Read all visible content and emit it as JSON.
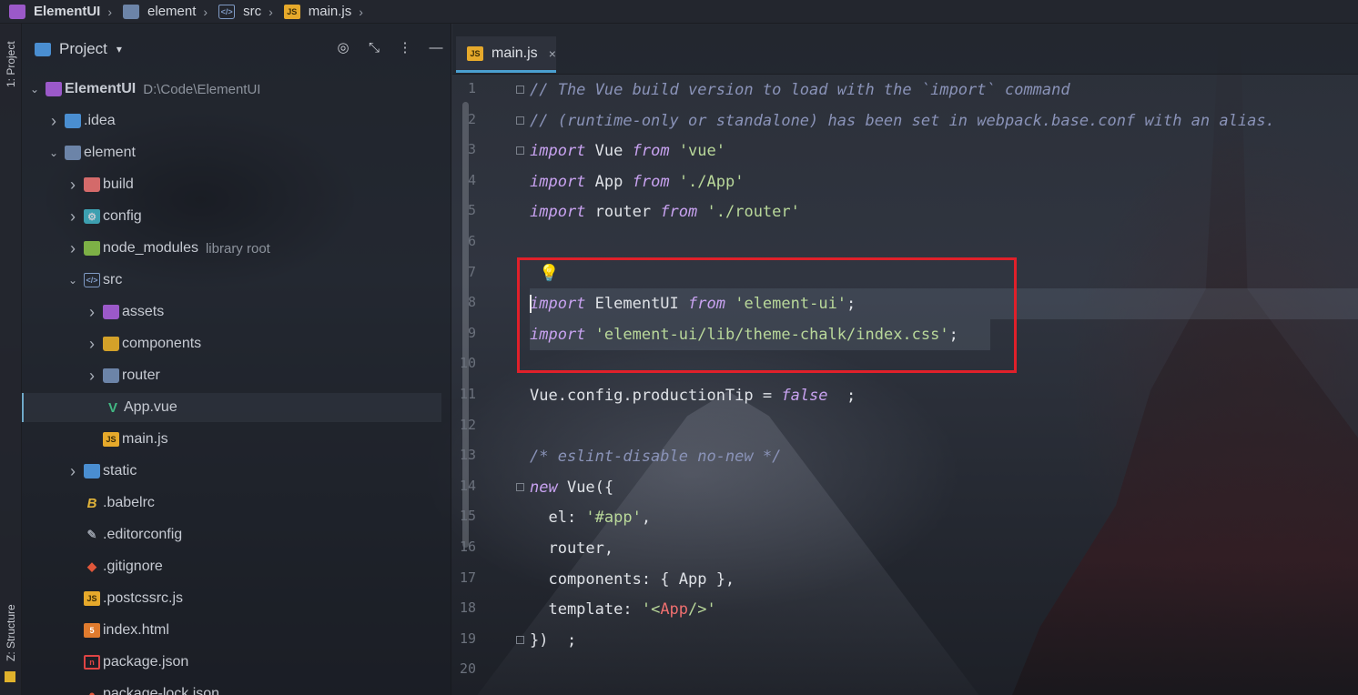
{
  "breadcrumb": [
    {
      "label": "ElementUI",
      "icon": "project-icon"
    },
    {
      "label": "element",
      "icon": "folder-icon"
    },
    {
      "label": "src",
      "icon": "src-folder-icon"
    },
    {
      "label": "main.js",
      "icon": "js-file-icon"
    }
  ],
  "toolstrip": {
    "project_tab": "1: Project",
    "structure_tab": "Z: Structure"
  },
  "project_panel": {
    "title": "Project",
    "dropdown_icon": "chevron-down-icon",
    "tools": [
      "locate-icon",
      "collapse-icon",
      "more-vertical-icon",
      "minimize-icon"
    ]
  },
  "tree": [
    {
      "name": "ElementUI",
      "suffix": "D:\\Code\\ElementUI",
      "depth": 0,
      "arrow": "down",
      "icon": "project"
    },
    {
      "name": ".idea",
      "suffix": "",
      "depth": 1,
      "arrow": "right",
      "icon": "folder-blue"
    },
    {
      "name": "element",
      "suffix": "",
      "depth": 1,
      "arrow": "down",
      "icon": "folder"
    },
    {
      "name": "build",
      "suffix": "",
      "depth": 2,
      "arrow": "right",
      "icon": "folder-red"
    },
    {
      "name": "config",
      "suffix": "",
      "depth": 2,
      "arrow": "right",
      "icon": "folder-teal"
    },
    {
      "name": "node_modules",
      "suffix": "library root",
      "depth": 2,
      "arrow": "right",
      "icon": "folder-green"
    },
    {
      "name": "src",
      "suffix": "",
      "depth": 2,
      "arrow": "down",
      "icon": "folder-src"
    },
    {
      "name": "assets",
      "suffix": "",
      "depth": 3,
      "arrow": "right",
      "icon": "folder-purple"
    },
    {
      "name": "components",
      "suffix": "",
      "depth": 3,
      "arrow": "right",
      "icon": "folder-yellow"
    },
    {
      "name": "router",
      "suffix": "",
      "depth": 3,
      "arrow": "right",
      "icon": "folder"
    },
    {
      "name": "App.vue",
      "suffix": "",
      "depth": 3,
      "arrow": "",
      "icon": "vue"
    },
    {
      "name": "main.js",
      "suffix": "",
      "depth": 3,
      "arrow": "",
      "icon": "js"
    },
    {
      "name": "static",
      "suffix": "",
      "depth": 2,
      "arrow": "right",
      "icon": "folder-blue"
    },
    {
      "name": ".babelrc",
      "suffix": "",
      "depth": 2,
      "arrow": "",
      "icon": "babel"
    },
    {
      "name": ".editorconfig",
      "suffix": "",
      "depth": 2,
      "arrow": "",
      "icon": "editorconfig"
    },
    {
      "name": ".gitignore",
      "suffix": "",
      "depth": 2,
      "arrow": "",
      "icon": "git"
    },
    {
      "name": ".postcssrc.js",
      "suffix": "",
      "depth": 2,
      "arrow": "",
      "icon": "js"
    },
    {
      "name": "index.html",
      "suffix": "",
      "depth": 2,
      "arrow": "",
      "icon": "html"
    },
    {
      "name": "package.json",
      "suffix": "",
      "depth": 2,
      "arrow": "",
      "icon": "npm"
    },
    {
      "name": "package-lock.json",
      "suffix": "",
      "depth": 2,
      "arrow": "",
      "icon": "lock"
    }
  ],
  "editor": {
    "tab_label": "main.js",
    "tab_close": "×",
    "lines": [
      [
        [
          "cm",
          "// The Vue build version to load with the `import` command"
        ]
      ],
      [
        [
          "cm",
          "// (runtime-only or standalone) has been set in webpack.base.conf with an alias."
        ]
      ],
      [
        [
          "kw",
          "import"
        ],
        [
          "txt",
          " Vue "
        ],
        [
          "kw",
          "from"
        ],
        [
          "txt",
          " "
        ],
        [
          "str",
          "'vue'"
        ]
      ],
      [
        [
          "kw",
          "import"
        ],
        [
          "txt",
          " App "
        ],
        [
          "kw",
          "from"
        ],
        [
          "txt",
          " "
        ],
        [
          "str",
          "'./App'"
        ]
      ],
      [
        [
          "kw",
          "import"
        ],
        [
          "txt",
          " router "
        ],
        [
          "kw",
          "from"
        ],
        [
          "txt",
          " "
        ],
        [
          "str",
          "'./router'"
        ]
      ],
      [],
      [
        [
          "bulb",
          "💡"
        ]
      ],
      [
        [
          "kw",
          "import"
        ],
        [
          "txt",
          " ElementUI "
        ],
        [
          "kw",
          "from"
        ],
        [
          "txt",
          " "
        ],
        [
          "str",
          "'element-ui'"
        ],
        [
          "txt",
          ";"
        ]
      ],
      [
        [
          "kw",
          "import"
        ],
        [
          "txt",
          " "
        ],
        [
          "str",
          "'element-ui/lib/theme-chalk/index.css'"
        ],
        [
          "txt",
          ";"
        ]
      ],
      [],
      [
        [
          "txt",
          "Vue.config.productionTip = "
        ],
        [
          "kw",
          "false"
        ],
        [
          "txt",
          "  ;"
        ]
      ],
      [],
      [
        [
          "cm",
          "/* eslint-disable no-new */"
        ]
      ],
      [
        [
          "kw",
          "new"
        ],
        [
          "txt",
          " Vue({"
        ]
      ],
      [
        [
          "txt",
          "  el: "
        ],
        [
          "str",
          "'#app'"
        ],
        [
          "txt",
          ","
        ]
      ],
      [
        [
          "txt",
          "  router,"
        ]
      ],
      [
        [
          "txt",
          "  components: { App },"
        ]
      ],
      [
        [
          "txt",
          "  template: "
        ],
        [
          "str",
          "'<"
        ],
        [
          "tag",
          "App"
        ],
        [
          "str",
          "/>'"
        ]
      ],
      [
        [
          "txt",
          "})  ;"
        ]
      ]
    ],
    "line_numbers": [
      "1",
      "2",
      "3",
      "4",
      "5",
      "6",
      "7",
      "8",
      "9",
      "10",
      "11",
      "12",
      "13",
      "14",
      "15",
      "16",
      "17",
      "18",
      "19",
      "20"
    ]
  },
  "colors": {
    "accent": "#4a9fd0",
    "highlight_box": "#e0202a",
    "keyword": "#c8a2f0",
    "string": "#b9d89a",
    "comment": "#8a93b8"
  }
}
